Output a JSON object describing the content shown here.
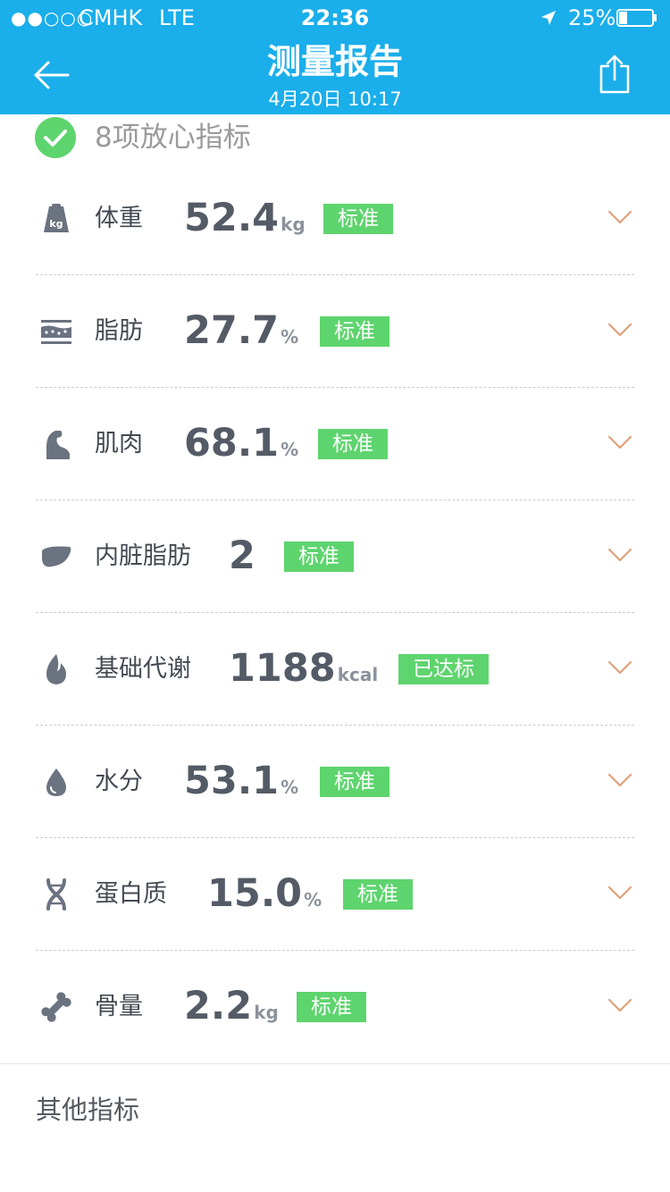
{
  "status_bar": {
    "signal": "●●○○○",
    "carrier": "CMHK",
    "network": "LTE",
    "time": "22:36",
    "battery_percent": "25%",
    "battery_level": 0.25
  },
  "header": {
    "title": "测量报告",
    "subtitle": "4月20日 10:17",
    "background": "#1aaeea"
  },
  "summary": {
    "text": "8项放心指标",
    "icon": "check-circle-icon",
    "color": "#5ed46e"
  },
  "metrics": [
    {
      "icon": "scale-kg-icon",
      "label": "体重",
      "value": "52.4",
      "unit": "kg",
      "status": "标准"
    },
    {
      "icon": "fat-layer-icon",
      "label": "脂肪",
      "value": "27.7",
      "unit": "%",
      "status": "标准"
    },
    {
      "icon": "muscle-arm-icon",
      "label": "肌肉",
      "value": "68.1",
      "unit": "%",
      "status": "标准"
    },
    {
      "icon": "organ-icon",
      "label": "内脏脂肪",
      "value": "2",
      "unit": "",
      "status": "标准"
    },
    {
      "icon": "flame-icon",
      "label": "基础代谢",
      "value": "1188",
      "unit": "kcal",
      "status": "已达标"
    },
    {
      "icon": "water-drop-icon",
      "label": "水分",
      "value": "53.1",
      "unit": "%",
      "status": "标准"
    },
    {
      "icon": "dna-icon",
      "label": "蛋白质",
      "value": "15.0",
      "unit": "%",
      "status": "标准"
    },
    {
      "icon": "bone-icon",
      "label": "骨量",
      "value": "2.2",
      "unit": "kg",
      "status": "标准"
    }
  ],
  "other_section": {
    "title": "其他指标"
  },
  "colors": {
    "badge": "#5ed46e",
    "chevron": "#e0a07a",
    "icon": "#6b7280"
  }
}
